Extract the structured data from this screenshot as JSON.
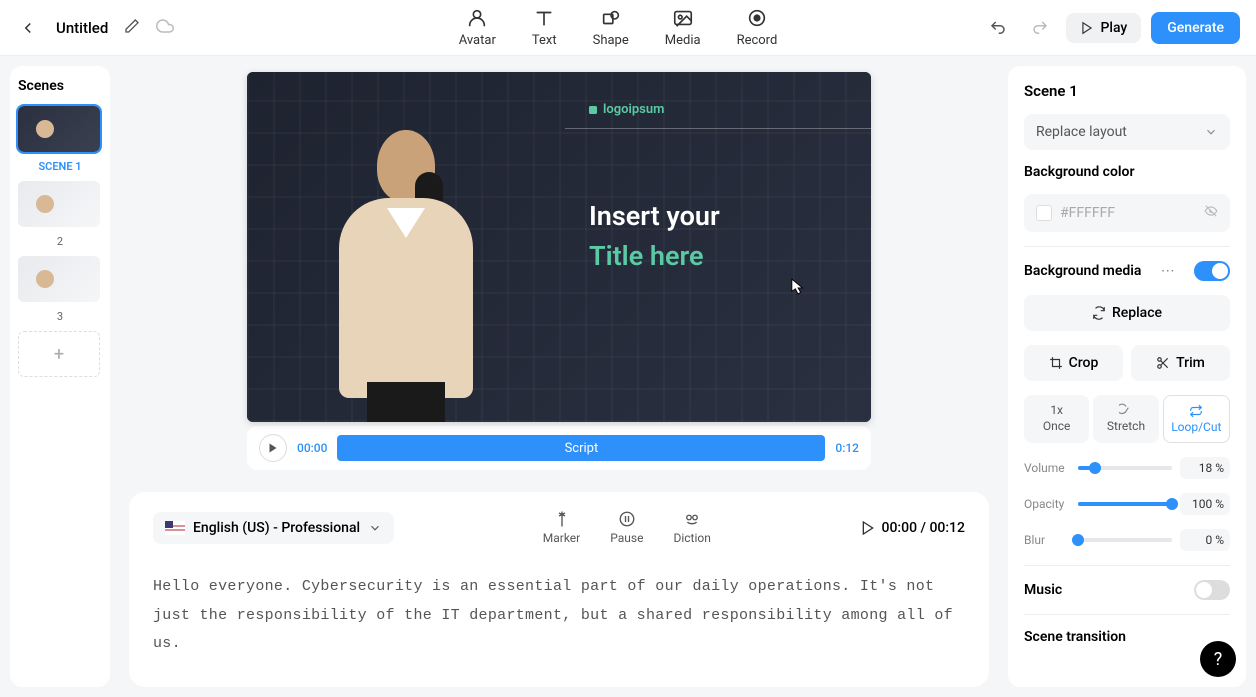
{
  "header": {
    "title": "Untitled",
    "tools": {
      "avatar": "Avatar",
      "text": "Text",
      "shape": "Shape",
      "media": "Media",
      "record": "Record"
    },
    "play": "Play",
    "generate": "Generate"
  },
  "scenes": {
    "title": "Scenes",
    "items": [
      {
        "label": "SCENE  1",
        "active": true
      },
      {
        "label": "2",
        "active": false
      },
      {
        "label": "3",
        "active": false
      }
    ]
  },
  "canvas": {
    "logo": "logoipsum",
    "line1": "Insert your",
    "line2": "Title here"
  },
  "timeline": {
    "start": "00:00",
    "label": "Script",
    "end": "0:12"
  },
  "script": {
    "voice": "English (US) - Professional",
    "tools": {
      "marker": "Marker",
      "pause": "Pause",
      "diction": "Diction"
    },
    "time": "00:00 / 00:12",
    "text": "Hello everyone. Cybersecurity is an essential part of our daily operations. It's not just the responsibility of the IT department, but a shared responsibility among all of us."
  },
  "right": {
    "scene_title": "Scene 1",
    "replace_layout": "Replace layout",
    "bg_color_label": "Background color",
    "bg_color_value": "#FFFFFF",
    "bg_media_label": "Background media",
    "replace": "Replace",
    "crop": "Crop",
    "trim": "Trim",
    "once_top": "1x",
    "once": "Once",
    "stretch": "Stretch",
    "loopcut": "Loop/Cut",
    "volume_label": "Volume",
    "volume_value": "18  %",
    "volume_pct": 18,
    "opacity_label": "Opacity",
    "opacity_value": "100  %",
    "opacity_pct": 100,
    "blur_label": "Blur",
    "blur_value": "0  %",
    "blur_pct": 0,
    "music_label": "Music",
    "transition_label": "Scene transition"
  },
  "help": "?"
}
